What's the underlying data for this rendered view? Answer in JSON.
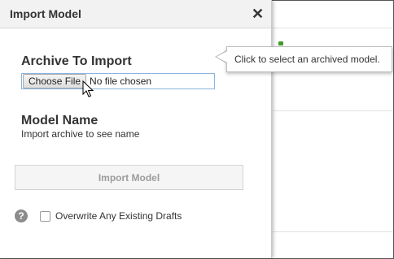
{
  "dialog": {
    "title": "Import Model",
    "close_glyph": "✕",
    "archive_section": {
      "heading": "Archive To Import",
      "choose_file_label": "Choose File",
      "file_status": "No file chosen"
    },
    "model_section": {
      "heading": "Model Name",
      "hint": "Import archive to see name"
    },
    "import_button_label": "Import Model",
    "help_glyph": "?",
    "overwrite_label": "Overwrite Any Existing Drafts",
    "overwrite_checked": false
  },
  "tooltip": {
    "text": "Click to select an archived model."
  },
  "colors": {
    "title_bar": "#f2f2f2",
    "input_border": "#8ab3e0",
    "disabled_text": "#9c9c9c",
    "background_accent": "#3f9a2a"
  }
}
